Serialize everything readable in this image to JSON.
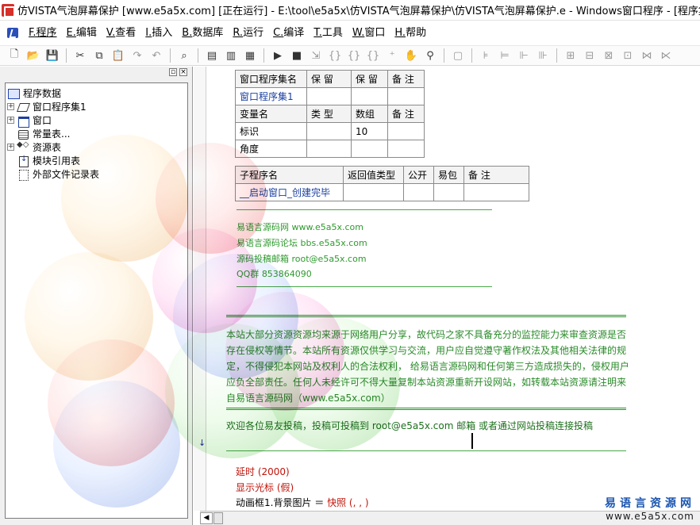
{
  "window": {
    "title": "仿VISTA气泡屏幕保护 [www.e5a5x.com] [正在运行] - E:\\tool\\e5a5x\\仿VISTA气泡屏幕保护\\仿VISTA气泡屏幕保护.e - Windows窗口程序 - [程序集:"
  },
  "menu": [
    {
      "key": "F.",
      "label": "程序"
    },
    {
      "key": "E.",
      "label": "编辑"
    },
    {
      "key": "V.",
      "label": "查看"
    },
    {
      "key": "I.",
      "label": "插入"
    },
    {
      "key": "B.",
      "label": "数据库"
    },
    {
      "key": "R.",
      "label": "运行"
    },
    {
      "key": "C.",
      "label": "编译"
    },
    {
      "key": "T.",
      "label": "工具"
    },
    {
      "key": "W.",
      "label": "窗口"
    },
    {
      "key": "H.",
      "label": "帮助"
    }
  ],
  "tree": {
    "root": "程序数据",
    "items": [
      {
        "label": "窗口程序集1",
        "icon": "program-set-icon",
        "expander": "+"
      },
      {
        "label": "窗口",
        "icon": "window-icon",
        "expander": "+"
      },
      {
        "label": "常量表...",
        "icon": "constant-table-icon",
        "expander": ""
      },
      {
        "label": "资源表",
        "icon": "resource-icon",
        "expander": "+"
      },
      {
        "label": "模块引用表",
        "icon": "module-ref-icon",
        "expander": ""
      },
      {
        "label": "外部文件记录表",
        "icon": "external-file-icon",
        "expander": ""
      }
    ]
  },
  "assembly_table": {
    "headers": [
      "窗口程序集名",
      "保 留",
      "保 留",
      "备 注"
    ],
    "name": "窗口程序集1"
  },
  "variable_table": {
    "headers": [
      "变量名",
      "类 型",
      "数组",
      "备 注"
    ],
    "rows": [
      {
        "name": "标识",
        "type": "",
        "array": "10",
        "note": ""
      },
      {
        "name": "角度",
        "type": "",
        "array": "",
        "note": ""
      }
    ]
  },
  "sub_table": {
    "headers": [
      "子程序名",
      "返回值类型",
      "公开",
      "易包",
      "备 注"
    ],
    "name": "__启动窗口_创建完毕"
  },
  "site_comments": [
    "易语言源码网    www.e5a5x.com",
    "易语言源码论坛    bbs.e5a5x.com",
    "源码投稿邮箱  root@e5a5x.com",
    "QQ群    853864090"
  ],
  "notice": "本站大部分资源资源均来源于网络用户分享，故代码之家不具备充分的监控能力来审查资源是否存在侵权等情节。本站所有资源仅供学习与交流，用户应自觉遵守著作权法及其他相关法律的规定，不得侵犯本网站及权利人的合法权利， 给易语言源码网和任何第三方造成损失的，侵权用户应负全部责任。任何人未经许可不得大量复制本站资源重新开设网站，如转载本站资源请注明来自易语言源码网（www.e5a5x.com）",
  "welcome": "欢迎各位易友投稿，投稿可投稿到     root@e5a5x.com   邮箱  或者通过网站投稿连接投稿",
  "code": {
    "line1": "延时 (2000)",
    "line2": "显示光标 (假)",
    "line3_prefix": "动画框1.背景图片 ＝ ",
    "line3_call": "快照 (, , )"
  },
  "watermark": {
    "line1": "易语言资源网",
    "line2": "www.e5a5x.com"
  },
  "colors": {
    "keyword_red": "#c0140a",
    "comment_green": "#2e9a2e",
    "link_blue": "#1a3fa0"
  }
}
